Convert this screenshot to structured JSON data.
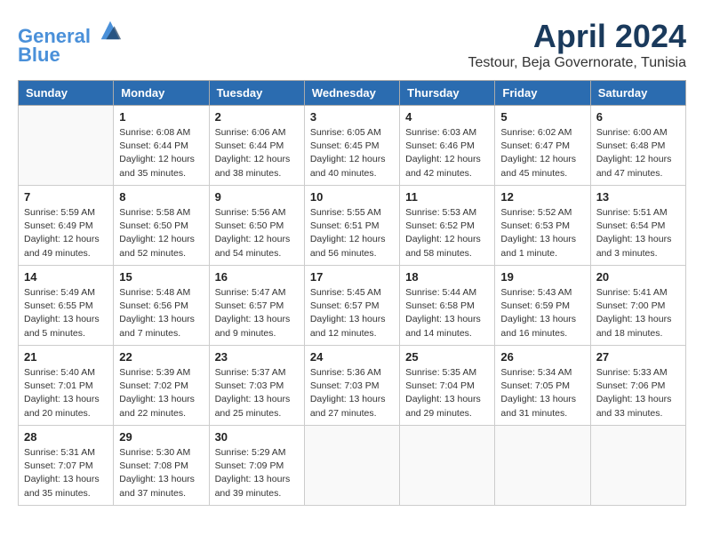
{
  "header": {
    "logo_line1": "General",
    "logo_line2": "Blue",
    "month": "April 2024",
    "location": "Testour, Beja Governorate, Tunisia"
  },
  "days_of_week": [
    "Sunday",
    "Monday",
    "Tuesday",
    "Wednesday",
    "Thursday",
    "Friday",
    "Saturday"
  ],
  "weeks": [
    [
      {
        "day": "",
        "info": ""
      },
      {
        "day": "1",
        "info": "Sunrise: 6:08 AM\nSunset: 6:44 PM\nDaylight: 12 hours\nand 35 minutes."
      },
      {
        "day": "2",
        "info": "Sunrise: 6:06 AM\nSunset: 6:44 PM\nDaylight: 12 hours\nand 38 minutes."
      },
      {
        "day": "3",
        "info": "Sunrise: 6:05 AM\nSunset: 6:45 PM\nDaylight: 12 hours\nand 40 minutes."
      },
      {
        "day": "4",
        "info": "Sunrise: 6:03 AM\nSunset: 6:46 PM\nDaylight: 12 hours\nand 42 minutes."
      },
      {
        "day": "5",
        "info": "Sunrise: 6:02 AM\nSunset: 6:47 PM\nDaylight: 12 hours\nand 45 minutes."
      },
      {
        "day": "6",
        "info": "Sunrise: 6:00 AM\nSunset: 6:48 PM\nDaylight: 12 hours\nand 47 minutes."
      }
    ],
    [
      {
        "day": "7",
        "info": "Sunrise: 5:59 AM\nSunset: 6:49 PM\nDaylight: 12 hours\nand 49 minutes."
      },
      {
        "day": "8",
        "info": "Sunrise: 5:58 AM\nSunset: 6:50 PM\nDaylight: 12 hours\nand 52 minutes."
      },
      {
        "day": "9",
        "info": "Sunrise: 5:56 AM\nSunset: 6:50 PM\nDaylight: 12 hours\nand 54 minutes."
      },
      {
        "day": "10",
        "info": "Sunrise: 5:55 AM\nSunset: 6:51 PM\nDaylight: 12 hours\nand 56 minutes."
      },
      {
        "day": "11",
        "info": "Sunrise: 5:53 AM\nSunset: 6:52 PM\nDaylight: 12 hours\nand 58 minutes."
      },
      {
        "day": "12",
        "info": "Sunrise: 5:52 AM\nSunset: 6:53 PM\nDaylight: 13 hours\nand 1 minute."
      },
      {
        "day": "13",
        "info": "Sunrise: 5:51 AM\nSunset: 6:54 PM\nDaylight: 13 hours\nand 3 minutes."
      }
    ],
    [
      {
        "day": "14",
        "info": "Sunrise: 5:49 AM\nSunset: 6:55 PM\nDaylight: 13 hours\nand 5 minutes."
      },
      {
        "day": "15",
        "info": "Sunrise: 5:48 AM\nSunset: 6:56 PM\nDaylight: 13 hours\nand 7 minutes."
      },
      {
        "day": "16",
        "info": "Sunrise: 5:47 AM\nSunset: 6:57 PM\nDaylight: 13 hours\nand 9 minutes."
      },
      {
        "day": "17",
        "info": "Sunrise: 5:45 AM\nSunset: 6:57 PM\nDaylight: 13 hours\nand 12 minutes."
      },
      {
        "day": "18",
        "info": "Sunrise: 5:44 AM\nSunset: 6:58 PM\nDaylight: 13 hours\nand 14 minutes."
      },
      {
        "day": "19",
        "info": "Sunrise: 5:43 AM\nSunset: 6:59 PM\nDaylight: 13 hours\nand 16 minutes."
      },
      {
        "day": "20",
        "info": "Sunrise: 5:41 AM\nSunset: 7:00 PM\nDaylight: 13 hours\nand 18 minutes."
      }
    ],
    [
      {
        "day": "21",
        "info": "Sunrise: 5:40 AM\nSunset: 7:01 PM\nDaylight: 13 hours\nand 20 minutes."
      },
      {
        "day": "22",
        "info": "Sunrise: 5:39 AM\nSunset: 7:02 PM\nDaylight: 13 hours\nand 22 minutes."
      },
      {
        "day": "23",
        "info": "Sunrise: 5:37 AM\nSunset: 7:03 PM\nDaylight: 13 hours\nand 25 minutes."
      },
      {
        "day": "24",
        "info": "Sunrise: 5:36 AM\nSunset: 7:03 PM\nDaylight: 13 hours\nand 27 minutes."
      },
      {
        "day": "25",
        "info": "Sunrise: 5:35 AM\nSunset: 7:04 PM\nDaylight: 13 hours\nand 29 minutes."
      },
      {
        "day": "26",
        "info": "Sunrise: 5:34 AM\nSunset: 7:05 PM\nDaylight: 13 hours\nand 31 minutes."
      },
      {
        "day": "27",
        "info": "Sunrise: 5:33 AM\nSunset: 7:06 PM\nDaylight: 13 hours\nand 33 minutes."
      }
    ],
    [
      {
        "day": "28",
        "info": "Sunrise: 5:31 AM\nSunset: 7:07 PM\nDaylight: 13 hours\nand 35 minutes."
      },
      {
        "day": "29",
        "info": "Sunrise: 5:30 AM\nSunset: 7:08 PM\nDaylight: 13 hours\nand 37 minutes."
      },
      {
        "day": "30",
        "info": "Sunrise: 5:29 AM\nSunset: 7:09 PM\nDaylight: 13 hours\nand 39 minutes."
      },
      {
        "day": "",
        "info": ""
      },
      {
        "day": "",
        "info": ""
      },
      {
        "day": "",
        "info": ""
      },
      {
        "day": "",
        "info": ""
      }
    ]
  ]
}
